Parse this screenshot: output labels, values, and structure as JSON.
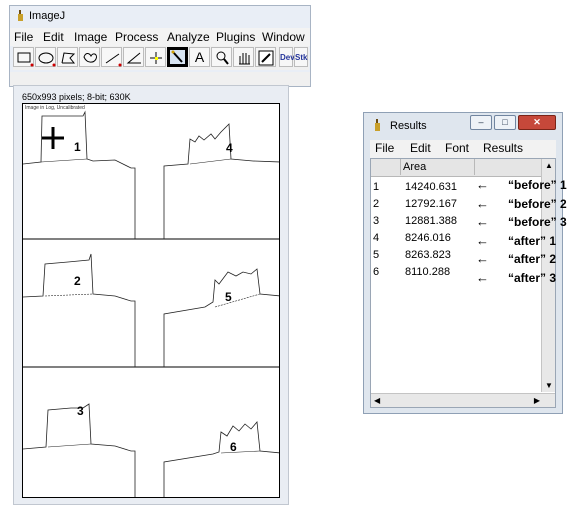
{
  "imagej": {
    "title": "ImageJ",
    "menu": [
      "File",
      "Edit",
      "Image",
      "Process",
      "Analyze",
      "Plugins",
      "Window"
    ],
    "tools": [
      "rectangle-tool-icon",
      "oval-tool-icon",
      "polygon-tool-icon",
      "freehand-tool-icon",
      "line-tool-icon",
      "angle-tool-icon",
      "point-tool-icon",
      "wand-tool-icon",
      "text-tool-icon",
      "magnifier-icon",
      "hand-tool-icon",
      "color-picker-icon"
    ],
    "text_tool": "A",
    "dev_label": "Dev",
    "stk_label": "Stk"
  },
  "image_window": {
    "info": "650x993 pixels; 8-bit; 630K",
    "tiny_label": "Image in Log, Uncalibrated",
    "labels": [
      "1",
      "2",
      "3",
      "4",
      "5",
      "6"
    ]
  },
  "results": {
    "title": "Results",
    "menu": [
      "File",
      "Edit",
      "Font",
      "Results"
    ],
    "column": "Area",
    "rows": [
      {
        "index": "1",
        "area": "14240.631"
      },
      {
        "index": "2",
        "area": "12792.167"
      },
      {
        "index": "3",
        "area": "12881.388"
      },
      {
        "index": "4",
        "area": "8246.016"
      },
      {
        "index": "5",
        "area": "8263.823"
      },
      {
        "index": "6",
        "area": "8110.288"
      }
    ]
  },
  "annotations": [
    "“before” 1",
    "“before” 2",
    "“before” 3",
    "“after” 1",
    "“after” 2",
    "“after” 3"
  ],
  "arrow_glyph": "←",
  "colors": {
    "selected_tool": "#d8e4f2",
    "close_button": "#c6483a",
    "window_chrome": "#dfe6ee"
  }
}
